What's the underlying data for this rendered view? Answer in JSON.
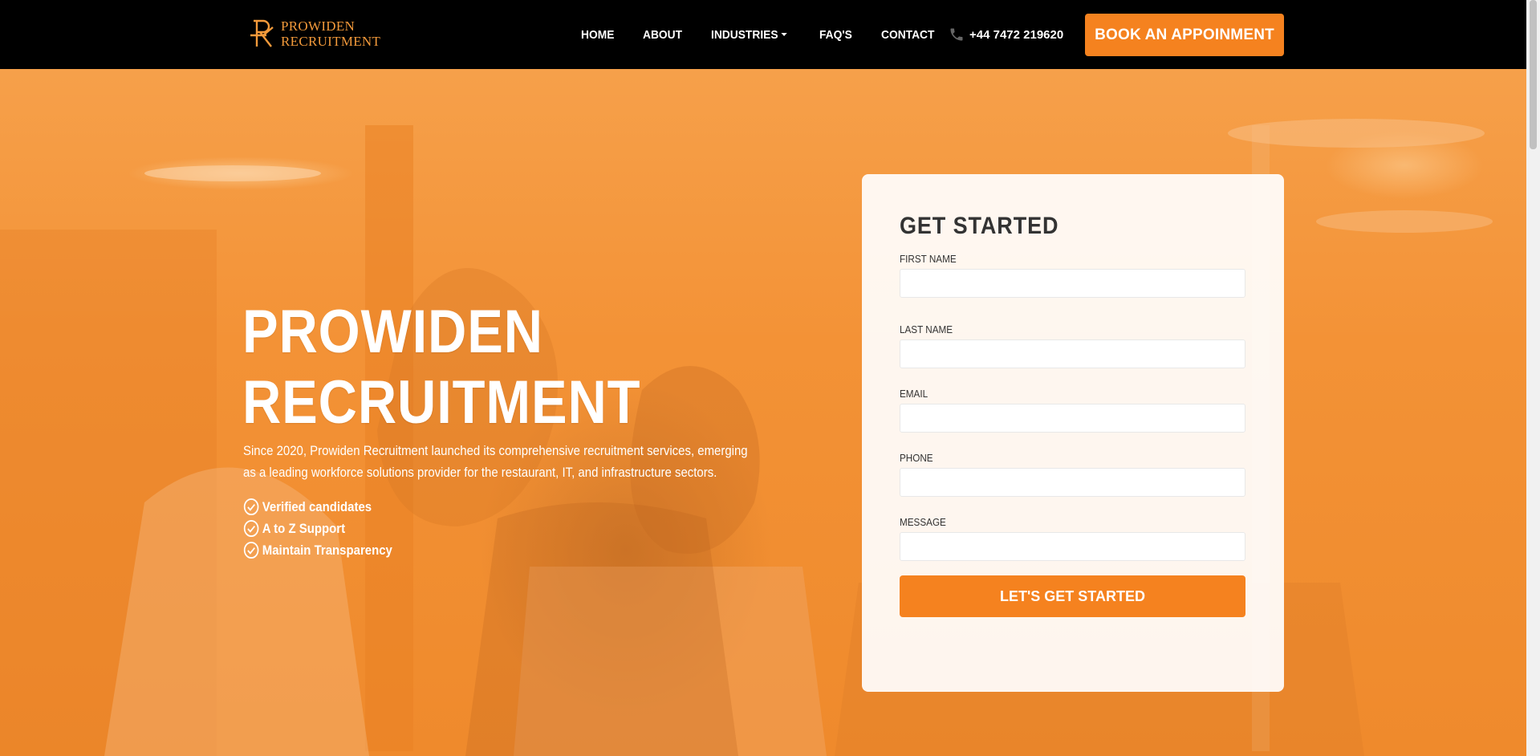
{
  "brand": {
    "name_line1": "PROWIDEN",
    "name_line2": "RECRUITMENT",
    "accent": "#f5821f",
    "logo_color": "#f39a3b"
  },
  "nav": {
    "items": [
      {
        "label": "HOME"
      },
      {
        "label": "ABOUT"
      },
      {
        "label": "INDUSTRIES",
        "dropdown": true
      },
      {
        "label": "FAQ'S"
      },
      {
        "label": "CONTACT"
      }
    ],
    "phone": "+44 7472 219620",
    "phone_icon": "phone-icon",
    "cta": "BOOK AN APPOINMENT"
  },
  "hero": {
    "title_line1": "PROWIDEN",
    "title_line2": "RECRUITMENT",
    "description": "Since 2020, Prowiden Recruitment launched its comprehensive recruitment services, emerging as a leading workforce solutions provider for the restaurant, IT, and infrastructure sectors.",
    "features": [
      "Verified candidates",
      "A to Z Support",
      "Maintain Transparency"
    ]
  },
  "form": {
    "title": "GET STARTED",
    "fields": [
      {
        "label": "FIRST NAME",
        "value": ""
      },
      {
        "label": "LAST NAME",
        "value": ""
      },
      {
        "label": "EMAIL",
        "value": ""
      },
      {
        "label": "PHONE",
        "value": ""
      },
      {
        "label": "MESSAGE",
        "value": ""
      }
    ],
    "submit": "LET'S GET STARTED"
  }
}
